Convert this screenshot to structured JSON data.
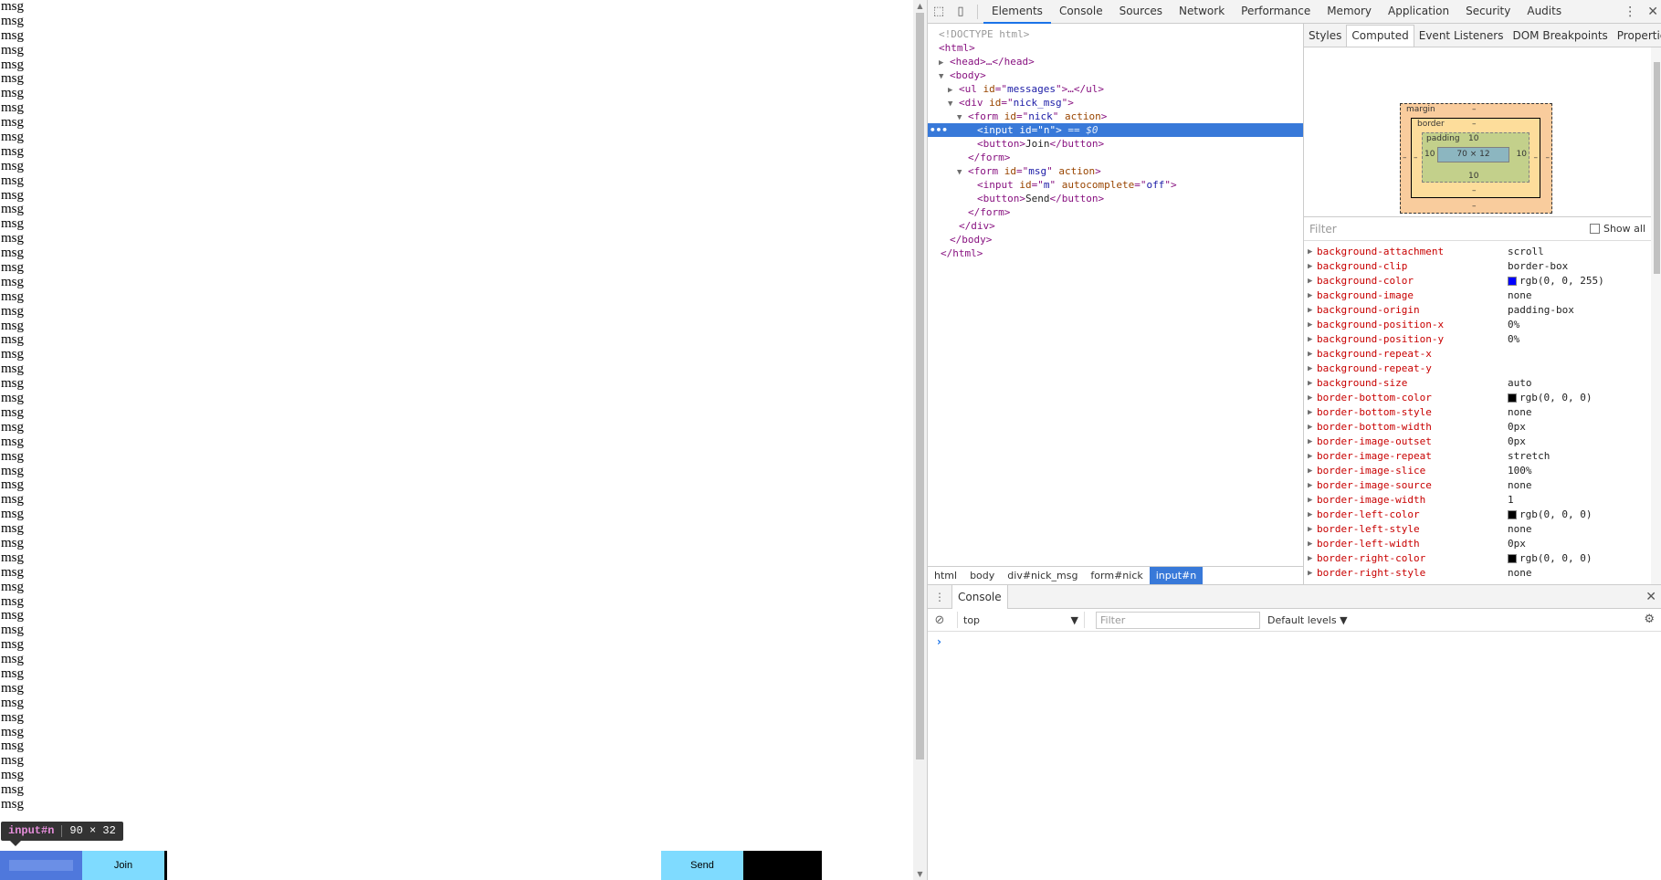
{
  "page": {
    "message_text": "msg",
    "message_count": 56,
    "join_label": "Join",
    "send_label": "Send"
  },
  "tooltip": {
    "tag": "input#n",
    "size": "90 × 32"
  },
  "devtools": {
    "tabs": [
      "Elements",
      "Console",
      "Sources",
      "Network",
      "Performance",
      "Memory",
      "Application",
      "Security",
      "Audits"
    ],
    "active_tab": "Elements",
    "dom": {
      "doctype": "<!DOCTYPE html>",
      "html_open": "<html>",
      "head": "<head>…</head>",
      "body_open": "<body>",
      "ul": {
        "tag": "ul",
        "attr": "id",
        "val": "messages",
        "rest": ">…</ul>"
      },
      "div": {
        "tag": "div",
        "attr": "id",
        "val": "nick_msg"
      },
      "form_nick": {
        "tag": "form",
        "attr": "id",
        "val": "nick",
        "attr2": "action"
      },
      "input_n": {
        "tag": "input",
        "attr": "id",
        "val": "n",
        "eq": "== $0"
      },
      "button_join": {
        "open": "<button>",
        "text": "Join",
        "close": "</button>"
      },
      "form_close": "</form>",
      "form_msg": {
        "tag": "form",
        "attr": "id",
        "val": "msg",
        "attr2": "action"
      },
      "input_m": {
        "tag": "input",
        "attr": "id",
        "val": "m",
        "attr2": "autocomplete",
        "val2": "off"
      },
      "button_send": {
        "open": "<button>",
        "text": "Send",
        "close": "</button>"
      },
      "div_close": "</div>",
      "body_close": "</body>",
      "html_close": "</html>"
    },
    "breadcrumbs": [
      "html",
      "body",
      "div#nick_msg",
      "form#nick",
      "input#n"
    ],
    "side_tabs": [
      "Styles",
      "Computed",
      "Event Listeners",
      "DOM Breakpoints",
      "Properties"
    ],
    "active_side_tab": "Computed",
    "box_model": {
      "margin_label": "margin",
      "margin": "–",
      "border_label": "border",
      "border": "–",
      "padding_label": "padding",
      "padding": "10",
      "content": "70 × 12",
      "padding_left": "10",
      "padding_right": "10",
      "padding_bottom": "10",
      "border_bottom": "–",
      "margin_bottom": "–",
      "margin_left": "–",
      "margin_right": "–",
      "border_left": "–",
      "border_right": "–"
    },
    "filter_placeholder": "Filter",
    "show_all_label": "Show all",
    "computed": [
      {
        "name": "background-attachment",
        "value": "scroll"
      },
      {
        "name": "background-clip",
        "value": "border-box"
      },
      {
        "name": "background-color",
        "value": "rgb(0, 0, 255)",
        "swatch": "#0000ff"
      },
      {
        "name": "background-image",
        "value": "none"
      },
      {
        "name": "background-origin",
        "value": "padding-box"
      },
      {
        "name": "background-position-x",
        "value": "0%"
      },
      {
        "name": "background-position-y",
        "value": "0%"
      },
      {
        "name": "background-repeat-x",
        "value": ""
      },
      {
        "name": "background-repeat-y",
        "value": ""
      },
      {
        "name": "background-size",
        "value": "auto"
      },
      {
        "name": "border-bottom-color",
        "value": "rgb(0, 0, 0)",
        "swatch": "#000000"
      },
      {
        "name": "border-bottom-style",
        "value": "none"
      },
      {
        "name": "border-bottom-width",
        "value": "0px"
      },
      {
        "name": "border-image-outset",
        "value": "0px"
      },
      {
        "name": "border-image-repeat",
        "value": "stretch"
      },
      {
        "name": "border-image-slice",
        "value": "100%"
      },
      {
        "name": "border-image-source",
        "value": "none"
      },
      {
        "name": "border-image-width",
        "value": "1"
      },
      {
        "name": "border-left-color",
        "value": "rgb(0, 0, 0)",
        "swatch": "#000000"
      },
      {
        "name": "border-left-style",
        "value": "none"
      },
      {
        "name": "border-left-width",
        "value": "0px"
      },
      {
        "name": "border-right-color",
        "value": "rgb(0, 0, 0)",
        "swatch": "#000000"
      },
      {
        "name": "border-right-style",
        "value": "none"
      }
    ],
    "console": {
      "tab": "Console",
      "context": "top",
      "filter_placeholder": "Filter",
      "levels": "Default levels",
      "prompt": "›"
    }
  }
}
